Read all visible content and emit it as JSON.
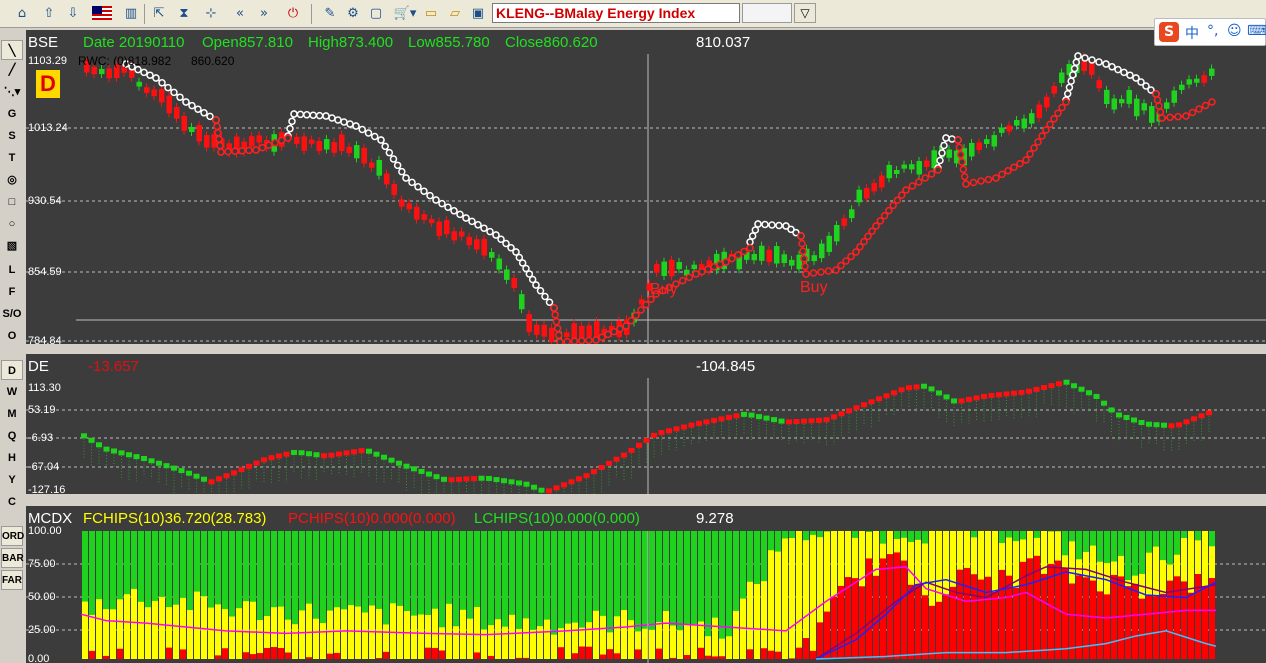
{
  "toolbar": {
    "ticker_value": "KLENG--BMalay  Energy Index",
    "dropdown_glyph": "▽",
    "icons": [
      "home-icon",
      "up-icon",
      "down-icon",
      "flag-malaysia-icon",
      "bar-chart-icon",
      "export-icon",
      "hourglass-icon",
      "network-icon",
      "rewind-icon",
      "fast-forward-icon",
      "power-icon",
      "draw-icon",
      "settings-icon",
      "screen-icon",
      "cart-icon",
      "folder-icon",
      "folder-open-icon",
      "save-icon"
    ]
  },
  "ime": {
    "logo": "S",
    "chars": [
      "中",
      "°,",
      "☺",
      "⌨"
    ]
  },
  "left_tools": {
    "draw": [
      "G",
      "S",
      "T",
      "L",
      "F",
      "S/O",
      "O"
    ],
    "periods": [
      "D",
      "W",
      "M",
      "Q",
      "H",
      "Y",
      "C"
    ],
    "modes": [
      "ORD",
      "BAR",
      "FAR"
    ]
  },
  "price_panel": {
    "symbol": "BSE",
    "date": "Date 20190110",
    "open": "Open857.810",
    "high": "High873.400",
    "low": "Low855.780",
    "close": "Close860.620",
    "cursor_value": "810.037",
    "rwc_label": "RWC: (0)818.982",
    "rwc_value": "860.620",
    "period_badge": "D",
    "top_label": "1103.29",
    "y_ticks": [
      "1013.24",
      "930.54",
      "854.59",
      "784.84"
    ],
    "signals": [
      "Buy",
      "Buy"
    ],
    "colors": {
      "up": "#1ed21e",
      "down": "#ff1010",
      "stop_white": "#ffffff",
      "stop_red": "#ff2020"
    }
  },
  "de_panel": {
    "name": "DE",
    "value": "-13.657",
    "cursor_value": "-104.845",
    "y_ticks": [
      "113.30",
      "53.19",
      "-6.93",
      "-67.04",
      "-127.16"
    ]
  },
  "mcdx_panel": {
    "name": "MCDX",
    "f_label": "FCHIPS(10)36.720(28.783)",
    "p_label": "PCHIPS(10)0.000(0.000)",
    "l_label": "LCHIPS(10)0.000(0.000)",
    "cursor_value": "9.278",
    "y_ticks": [
      "100.00",
      "75.00",
      "50.00",
      "25.00",
      "0.00"
    ],
    "colors": {
      "green": "#1ed21e",
      "yellow": "#ffff00",
      "red": "#ff0000",
      "pink": "#ff00ff",
      "purple": "#800080",
      "blue": "#2020ff",
      "cyan": "#40c0ff"
    }
  }
}
